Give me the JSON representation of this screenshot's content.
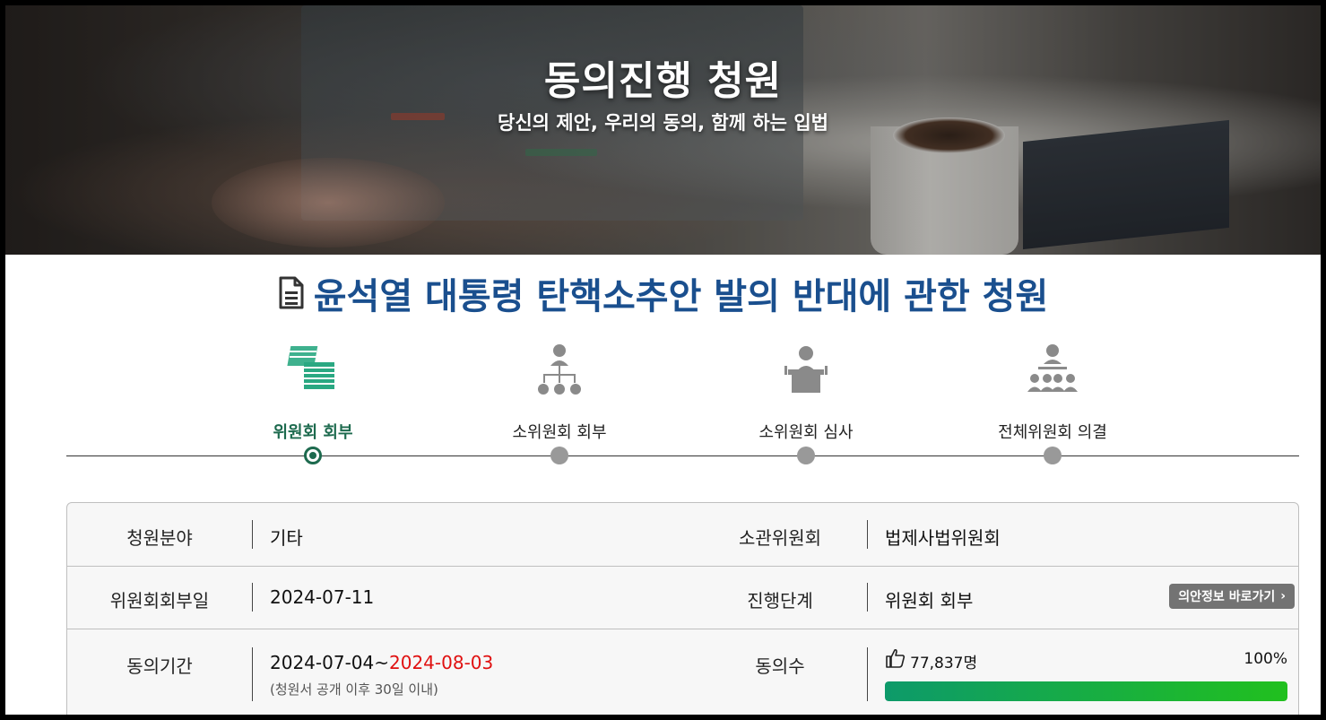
{
  "banner": {
    "title": "동의진행 청원",
    "subtitle": "당신의 제안, 우리의 동의, 함께 하는 입법"
  },
  "petition": {
    "title": "윤석열 대통령 탄핵소추안 발의 반대에 관한 청원"
  },
  "steps": [
    {
      "label": "위원회 회부",
      "icon": "documents-stack-icon",
      "active": true
    },
    {
      "label": "소위원회 회부",
      "icon": "org-chart-icon",
      "active": false
    },
    {
      "label": "소위원회 심사",
      "icon": "podium-speaker-icon",
      "active": false
    },
    {
      "label": "전체위원회 의결",
      "icon": "assembly-meeting-icon",
      "active": false
    }
  ],
  "info": {
    "field_label": "청원분야",
    "field_value": "기타",
    "committee_label": "소관위원회",
    "committee_value": "법제사법위원회",
    "referral_date_label": "위원회회부일",
    "referral_date_value": "2024-07-11",
    "stage_label": "진행단계",
    "stage_value": "위원회 회부",
    "bill_info_button": "의안정보 바로가기",
    "period_label": "동의기간",
    "period_start": "2024-07-04~",
    "period_end": "2024-08-03",
    "period_note": "(청원서 공개 이후 30일 이내)",
    "agree_label": "동의수",
    "agree_count": "77,837명",
    "agree_percent_text": "100%",
    "agree_percent": 100
  },
  "colors": {
    "title_blue": "#1a4f8e",
    "active_green": "#1d6a4e",
    "deadline_red": "#e01010"
  }
}
